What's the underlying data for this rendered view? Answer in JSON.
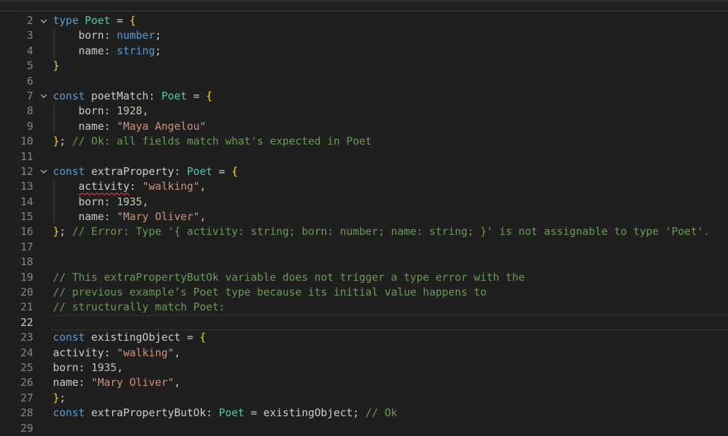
{
  "editor": {
    "lines": [
      {
        "n": "2",
        "fold": true,
        "guide": false,
        "current": false,
        "tokens": [
          {
            "t": "type",
            "c": "kw"
          },
          {
            "t": " ",
            "c": "id"
          },
          {
            "t": "Poet",
            "c": "ty"
          },
          {
            "t": " = ",
            "c": "id"
          },
          {
            "t": "{",
            "c": "br"
          }
        ]
      },
      {
        "n": "3",
        "fold": false,
        "guide": true,
        "current": false,
        "tokens": [
          {
            "t": "    born: ",
            "c": "id"
          },
          {
            "t": "number",
            "c": "kw"
          },
          {
            "t": ";",
            "c": "id"
          }
        ]
      },
      {
        "n": "4",
        "fold": false,
        "guide": true,
        "current": false,
        "tokens": [
          {
            "t": "    name: ",
            "c": "id"
          },
          {
            "t": "string",
            "c": "kw"
          },
          {
            "t": ";",
            "c": "id"
          }
        ]
      },
      {
        "n": "5",
        "fold": false,
        "guide": false,
        "current": false,
        "tokens": [
          {
            "t": "}",
            "c": "br"
          }
        ]
      },
      {
        "n": "6",
        "fold": false,
        "guide": false,
        "current": false,
        "tokens": []
      },
      {
        "n": "7",
        "fold": true,
        "guide": false,
        "current": false,
        "tokens": [
          {
            "t": "const",
            "c": "kw"
          },
          {
            "t": " poetMatch: ",
            "c": "id"
          },
          {
            "t": "Poet",
            "c": "ty"
          },
          {
            "t": " = ",
            "c": "id"
          },
          {
            "t": "{",
            "c": "br"
          }
        ]
      },
      {
        "n": "8",
        "fold": false,
        "guide": true,
        "current": false,
        "tokens": [
          {
            "t": "    born: ",
            "c": "id"
          },
          {
            "t": "1928",
            "c": "num"
          },
          {
            "t": ",",
            "c": "id"
          }
        ]
      },
      {
        "n": "9",
        "fold": false,
        "guide": true,
        "current": false,
        "tokens": [
          {
            "t": "    name: ",
            "c": "id"
          },
          {
            "t": "\"Maya Angelou\"",
            "c": "str"
          }
        ]
      },
      {
        "n": "10",
        "fold": false,
        "guide": false,
        "current": false,
        "tokens": [
          {
            "t": "}",
            "c": "br"
          },
          {
            "t": "; ",
            "c": "id"
          },
          {
            "t": "// Ok: all fields match what's expected in Poet",
            "c": "cm"
          }
        ]
      },
      {
        "n": "11",
        "fold": false,
        "guide": false,
        "current": false,
        "tokens": []
      },
      {
        "n": "12",
        "fold": true,
        "guide": false,
        "current": false,
        "tokens": [
          {
            "t": "const",
            "c": "kw"
          },
          {
            "t": " extraProperty: ",
            "c": "id"
          },
          {
            "t": "Poet",
            "c": "ty"
          },
          {
            "t": " = ",
            "c": "id"
          },
          {
            "t": "{",
            "c": "br"
          }
        ]
      },
      {
        "n": "13",
        "fold": false,
        "guide": true,
        "current": false,
        "tokens": [
          {
            "t": "    ",
            "c": "id"
          },
          {
            "t": "activity",
            "c": "id err"
          },
          {
            "t": ": ",
            "c": "id"
          },
          {
            "t": "\"walking\"",
            "c": "str"
          },
          {
            "t": ",",
            "c": "id"
          }
        ]
      },
      {
        "n": "14",
        "fold": false,
        "guide": true,
        "current": false,
        "tokens": [
          {
            "t": "    born: ",
            "c": "id"
          },
          {
            "t": "1935",
            "c": "num"
          },
          {
            "t": ",",
            "c": "id"
          }
        ]
      },
      {
        "n": "15",
        "fold": false,
        "guide": true,
        "current": false,
        "tokens": [
          {
            "t": "    name: ",
            "c": "id"
          },
          {
            "t": "\"Mary Oliver\"",
            "c": "str"
          },
          {
            "t": ",",
            "c": "id"
          }
        ]
      },
      {
        "n": "16",
        "fold": false,
        "guide": false,
        "current": false,
        "tokens": [
          {
            "t": "}",
            "c": "br"
          },
          {
            "t": "; ",
            "c": "id"
          },
          {
            "t": "// Error: Type '{ activity: string; born: number; name: string; }' is not assignable to type 'Poet'.",
            "c": "cm"
          }
        ]
      },
      {
        "n": "17",
        "fold": false,
        "guide": false,
        "current": false,
        "tokens": []
      },
      {
        "n": "18",
        "fold": false,
        "guide": false,
        "current": false,
        "tokens": []
      },
      {
        "n": "19",
        "fold": false,
        "guide": false,
        "current": false,
        "tokens": [
          {
            "t": "// This extraPropertyButOk variable does not trigger a type error with the",
            "c": "cm"
          }
        ]
      },
      {
        "n": "20",
        "fold": false,
        "guide": false,
        "current": false,
        "tokens": [
          {
            "t": "// previous example’s Poet type because its initial value happens to",
            "c": "cm"
          }
        ]
      },
      {
        "n": "21",
        "fold": false,
        "guide": false,
        "current": false,
        "tokens": [
          {
            "t": "// structurally match Poet:",
            "c": "cm"
          }
        ]
      },
      {
        "n": "22",
        "fold": false,
        "guide": false,
        "current": true,
        "tokens": []
      },
      {
        "n": "23",
        "fold": false,
        "guide": false,
        "current": false,
        "tokens": [
          {
            "t": "const",
            "c": "kw"
          },
          {
            "t": " existingObject = ",
            "c": "id"
          },
          {
            "t": "{",
            "c": "br"
          }
        ]
      },
      {
        "n": "24",
        "fold": false,
        "guide": false,
        "current": false,
        "tokens": [
          {
            "t": "activity: ",
            "c": "id"
          },
          {
            "t": "\"walking\"",
            "c": "str"
          },
          {
            "t": ",",
            "c": "id"
          }
        ]
      },
      {
        "n": "25",
        "fold": false,
        "guide": false,
        "current": false,
        "tokens": [
          {
            "t": "born: ",
            "c": "id"
          },
          {
            "t": "1935",
            "c": "num"
          },
          {
            "t": ",",
            "c": "id"
          }
        ]
      },
      {
        "n": "26",
        "fold": false,
        "guide": false,
        "current": false,
        "tokens": [
          {
            "t": "name: ",
            "c": "id"
          },
          {
            "t": "\"Mary Oliver\"",
            "c": "str"
          },
          {
            "t": ",",
            "c": "id"
          }
        ]
      },
      {
        "n": "27",
        "fold": false,
        "guide": false,
        "current": false,
        "tokens": [
          {
            "t": "}",
            "c": "br"
          },
          {
            "t": ";",
            "c": "id"
          }
        ]
      },
      {
        "n": "28",
        "fold": false,
        "guide": false,
        "current": false,
        "tokens": [
          {
            "t": "const",
            "c": "kw"
          },
          {
            "t": " extraPropertyButOk: ",
            "c": "id"
          },
          {
            "t": "Poet",
            "c": "ty"
          },
          {
            "t": " = existingObject; ",
            "c": "id"
          },
          {
            "t": "// Ok",
            "c": "cm"
          }
        ]
      },
      {
        "n": "29",
        "fold": false,
        "guide": false,
        "current": false,
        "tokens": []
      }
    ],
    "fold_icon": "chevron-down-icon"
  }
}
